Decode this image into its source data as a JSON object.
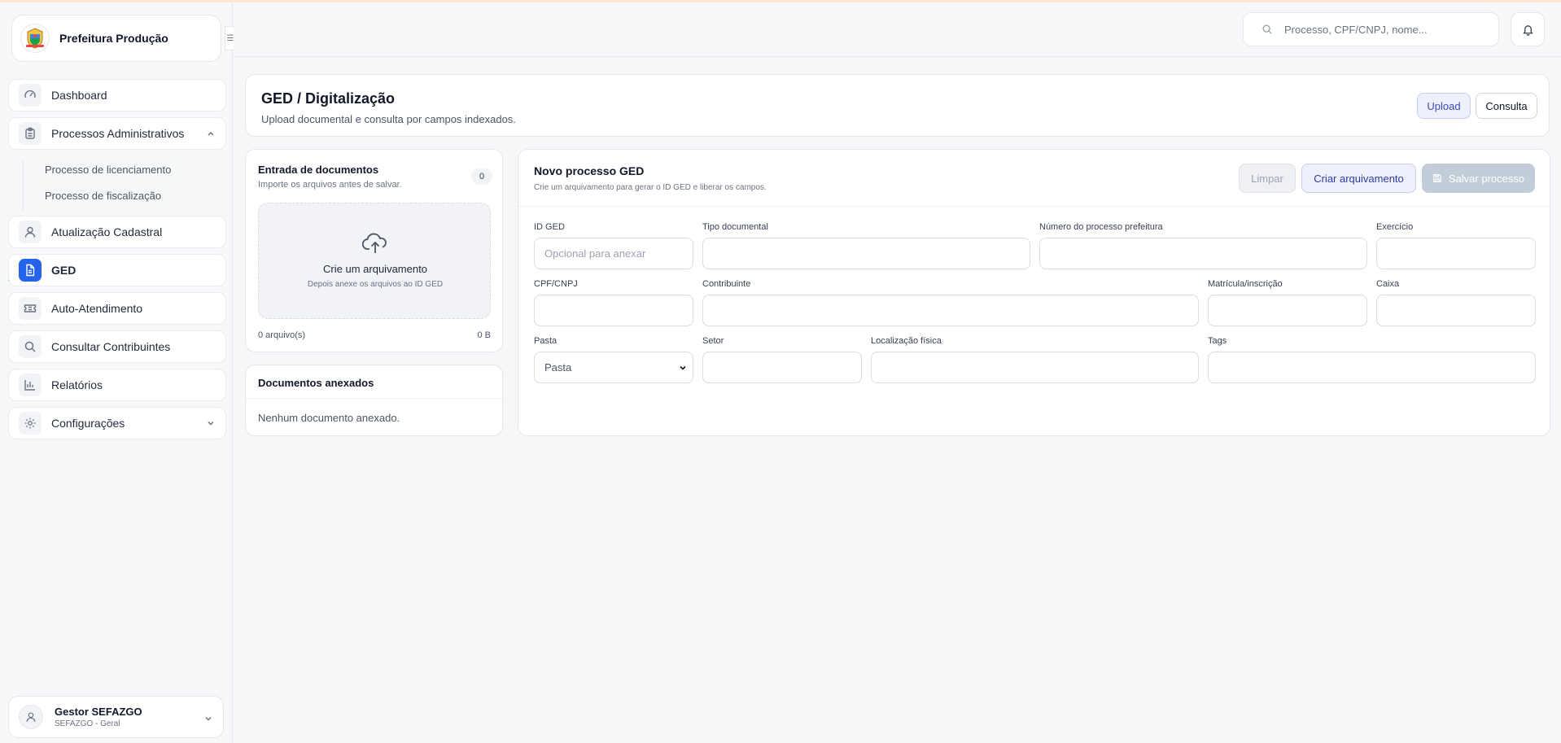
{
  "sidebar": {
    "brand": "Prefeitura Produção",
    "items": [
      {
        "label": "Dashboard"
      },
      {
        "label": "Processos Administrativos"
      },
      {
        "label": "Atualização Cadastral"
      },
      {
        "label": "GED"
      },
      {
        "label": "Auto-Atendimento"
      },
      {
        "label": "Consultar Contribuintes"
      },
      {
        "label": "Relatórios"
      },
      {
        "label": "Configurações"
      }
    ],
    "subitems": [
      {
        "label": "Processo de licenciamento"
      },
      {
        "label": "Processo de fiscalização"
      }
    ],
    "user": {
      "name": "Gestor SEFAZGO",
      "org": "SEFAZGO - Geral"
    }
  },
  "topbar": {
    "search_placeholder": "Processo, CPF/CNPJ, nome..."
  },
  "header": {
    "title": "GED / Digitalização",
    "subtitle": "Upload documental e consulta por campos indexados.",
    "upload_label": "Upload",
    "consulta_label": "Consulta"
  },
  "entrada": {
    "title": "Entrada de documentos",
    "subtitle": "Importe os arquivos antes de salvar.",
    "count": "0",
    "dropzone_title": "Crie um arquivamento",
    "dropzone_sub": "Depois anexe os arquivos ao ID GED",
    "files_count": "0 arquivo(s)",
    "total_size": "0 B"
  },
  "anexados": {
    "title": "Documentos anexados",
    "empty": "Nenhum documento anexado."
  },
  "form": {
    "title": "Novo processo GED",
    "subtitle": "Crie um arquivamento para gerar o ID GED e liberar os campos.",
    "limpar_label": "Limpar",
    "criar_label": "Criar arquivamento",
    "salvar_label": "Salvar processo",
    "fields": {
      "id_ged": {
        "label": "ID GED",
        "placeholder": "Opcional para anexar"
      },
      "tipo": {
        "label": "Tipo documental"
      },
      "numero": {
        "label": "Número do processo prefeitura"
      },
      "exercicio": {
        "label": "Exercício"
      },
      "cpf": {
        "label": "CPF/CNPJ"
      },
      "contribuinte": {
        "label": "Contribuinte"
      },
      "matricula": {
        "label": "Matrícula/inscrição"
      },
      "caixa": {
        "label": "Caixa"
      },
      "pasta": {
        "label": "Pasta",
        "value": "Pasta"
      },
      "setor": {
        "label": "Setor"
      },
      "localizacao": {
        "label": "Localização física"
      },
      "tags": {
        "label": "Tags"
      }
    }
  }
}
